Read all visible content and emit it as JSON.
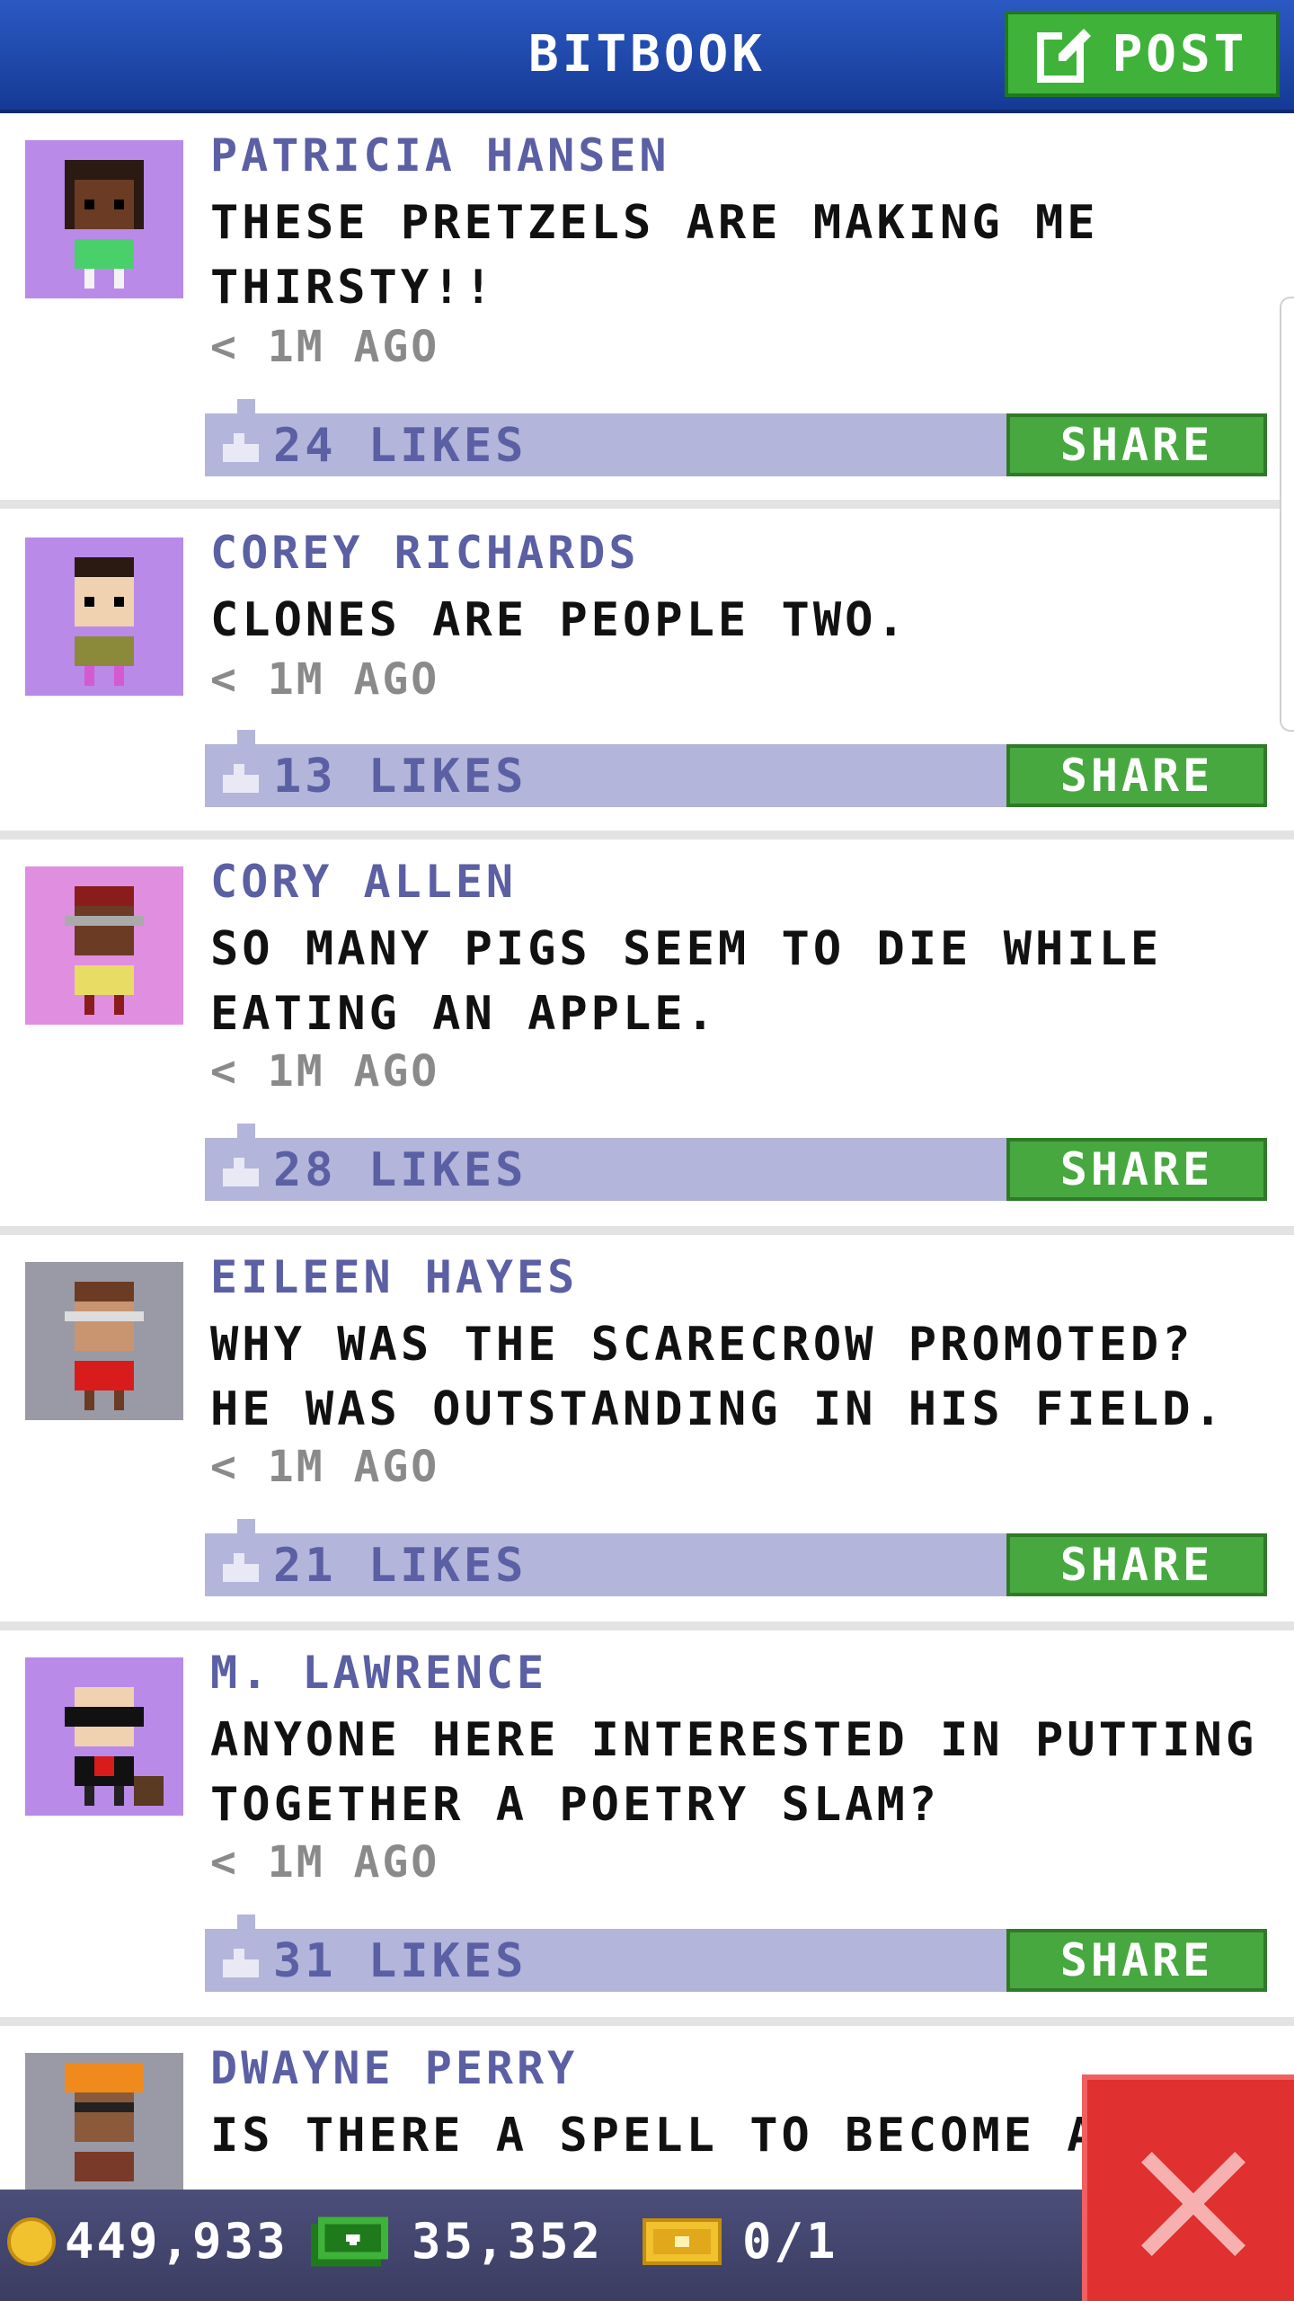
{
  "header": {
    "title": "BITBOOK",
    "post_label": "POST"
  },
  "posts": [
    {
      "author": "PATRICIA HANSEN",
      "text": "THESE PRETZELS ARE MAKING ME THIRSTY!!",
      "time": "< 1M AGO",
      "likes": "24 LIKES",
      "share": "SHARE",
      "avatar_bg": "#b98ae8"
    },
    {
      "author": "COREY RICHARDS",
      "text": "CLONES ARE PEOPLE TWO.",
      "time": "< 1M AGO",
      "likes": "13 LIKES",
      "share": "SHARE",
      "avatar_bg": "#b98ae8"
    },
    {
      "author": "CORY ALLEN",
      "text": "SO MANY PIGS SEEM TO DIE WHILE EATING AN APPLE.",
      "time": "< 1M AGO",
      "likes": "28 LIKES",
      "share": "SHARE",
      "avatar_bg": "#e08ee0"
    },
    {
      "author": "EILEEN HAYES",
      "text": "WHY WAS THE SCARECROW PROMOTED? HE WAS OUTSTANDING IN HIS FIELD.",
      "time": "< 1M AGO",
      "likes": "21 LIKES",
      "share": "SHARE",
      "avatar_bg": "#9a9aa6"
    },
    {
      "author": "M. LAWRENCE",
      "text": "ANYONE HERE INTERESTED IN PUTTING TOGETHER A POETRY SLAM?",
      "time": "< 1M AGO",
      "likes": "31 LIKES",
      "share": "SHARE",
      "avatar_bg": "#b98ae8"
    },
    {
      "author": "DWAYNE PERRY",
      "text": "IS THERE A SPELL TO BECOME A",
      "time": "",
      "likes": "",
      "share": "",
      "avatar_bg": "#9a9aa6"
    }
  ],
  "status": {
    "coins": "449,933",
    "bux": "35,352",
    "tickets": "0/1"
  },
  "colors": {
    "header": "#1f47aa",
    "post_button": "#3fb23a",
    "likes_bar": "#b3b5da",
    "share_button": "#47a83f",
    "name_text": "#5b5fa3",
    "close_button": "#e03030"
  },
  "icons": {
    "post": "edit-icon",
    "like": "thumb-icon",
    "coin": "coin-icon",
    "bux": "bux-icon",
    "ticket": "ticket-icon",
    "close": "close-icon"
  }
}
